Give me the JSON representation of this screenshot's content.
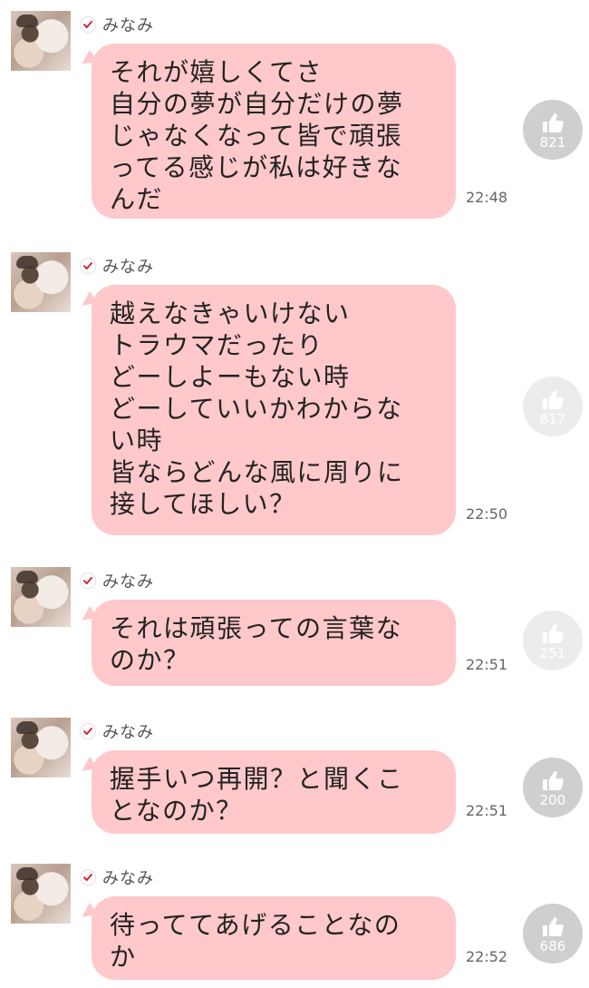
{
  "messages": [
    {
      "sender": "みなみ",
      "text": "それが嬉しくてさ\n自分の夢が自分だけの夢\nじゃなくなって皆で頑張\nってる感じが私は好きな\nんだ",
      "time": "22:48",
      "likes": "821",
      "like_faded": false
    },
    {
      "sender": "みなみ",
      "text": "越えなきゃいけない\nトラウマだったり\nどーしよーもない時\nどーしていいかわからな\nい時\n皆ならどんな風に周りに\n接してほしい？",
      "time": "22:50",
      "likes": "817",
      "like_faded": true
    },
    {
      "sender": "みなみ",
      "text": "それは頑張っての言葉な\nのか？",
      "time": "22:51",
      "likes": "251",
      "like_faded": true
    },
    {
      "sender": "みなみ",
      "text": "握手いつ再開？と聞くこ\nとなのか？",
      "time": "22:51",
      "likes": "200",
      "like_faded": false
    },
    {
      "sender": "みなみ",
      "text": "待っててあげることなの\nか",
      "time": "22:52",
      "likes": "686",
      "like_faded": false
    }
  ],
  "icons": {
    "verified": "check-icon",
    "like": "thumbs-up-icon"
  },
  "colors": {
    "bubble": "#ffc8ca",
    "like_button": "#cfcfcf",
    "like_button_faded": "#ececec",
    "verified_check": "#d3253a"
  }
}
